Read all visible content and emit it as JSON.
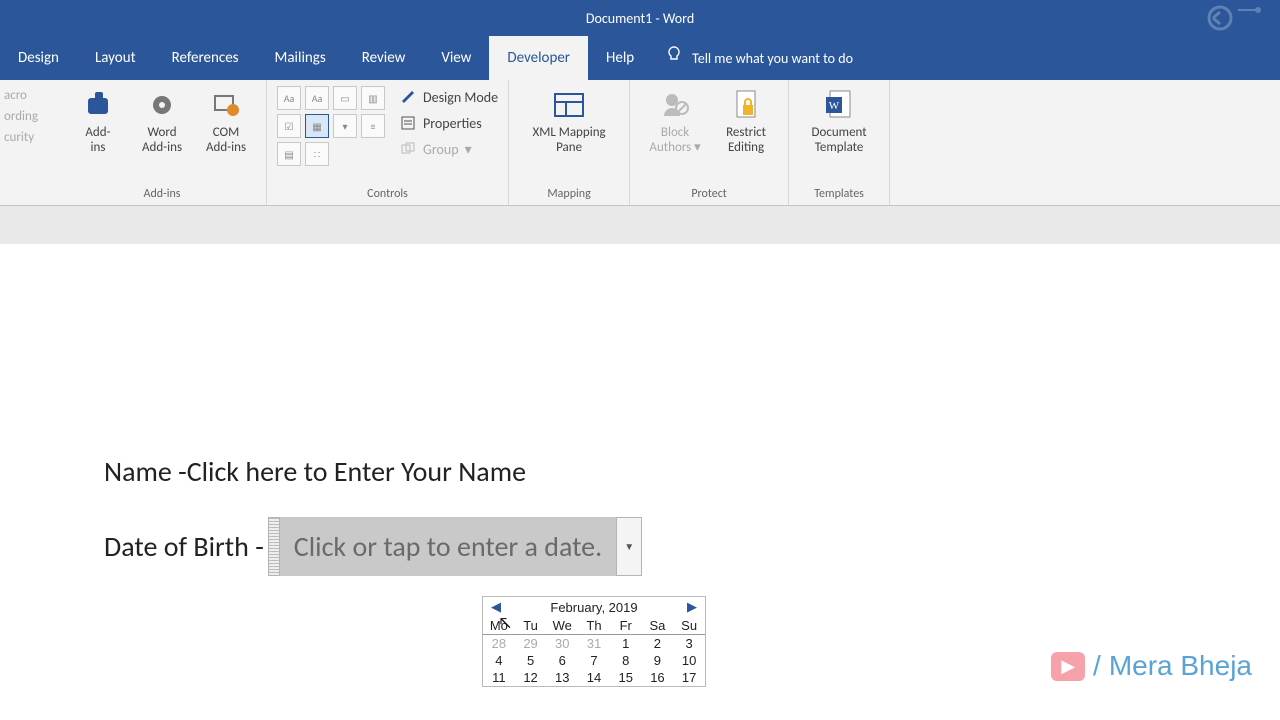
{
  "titlebar": {
    "title": "Document1  -  Word"
  },
  "tabs": [
    {
      "label": "Design",
      "active": false
    },
    {
      "label": "Layout",
      "active": false
    },
    {
      "label": "References",
      "active": false
    },
    {
      "label": "Mailings",
      "active": false
    },
    {
      "label": "Review",
      "active": false
    },
    {
      "label": "View",
      "active": false
    },
    {
      "label": "Developer",
      "active": true
    },
    {
      "label": "Help",
      "active": false
    }
  ],
  "tellme": "Tell me what you want to do",
  "leftcut": [
    "acro",
    "ording",
    "curity"
  ],
  "groups": {
    "addins": {
      "label": "Add-ins",
      "items": [
        {
          "line1": "Add-",
          "line2": "ins"
        },
        {
          "line1": "Word",
          "line2": "Add-ins"
        },
        {
          "line1": "COM",
          "line2": "Add-ins"
        }
      ]
    },
    "controls": {
      "label": "Controls",
      "right": {
        "design": "Design Mode",
        "properties": "Properties",
        "group": "Group"
      }
    },
    "mapping": {
      "label": "Mapping",
      "btn1": "XML Mapping",
      "btn2": "Pane"
    },
    "protect": {
      "label": "Protect",
      "block1": "Block",
      "block2": "Authors",
      "rest1": "Restrict",
      "rest2": "Editing"
    },
    "templates": {
      "label": "Templates",
      "t1": "Document",
      "t2": "Template"
    }
  },
  "doc": {
    "name_label": "Name -",
    "name_placeholder": "Click here to Enter Your Name",
    "dob_label": "Date of Birth -",
    "dob_placeholder": "Click or tap to enter a date."
  },
  "calendar": {
    "title": "February, 2019",
    "days": [
      "Mo",
      "Tu",
      "We",
      "Th",
      "Fr",
      "Sa",
      "Su"
    ],
    "rows": [
      [
        {
          "n": "28",
          "o": true
        },
        {
          "n": "29",
          "o": true
        },
        {
          "n": "30",
          "o": true
        },
        {
          "n": "31",
          "o": true
        },
        {
          "n": "1"
        },
        {
          "n": "2"
        },
        {
          "n": "3"
        }
      ],
      [
        {
          "n": "4"
        },
        {
          "n": "5"
        },
        {
          "n": "6"
        },
        {
          "n": "7"
        },
        {
          "n": "8"
        },
        {
          "n": "9"
        },
        {
          "n": "10"
        }
      ],
      [
        {
          "n": "11"
        },
        {
          "n": "12"
        },
        {
          "n": "13"
        },
        {
          "n": "14"
        },
        {
          "n": "15"
        },
        {
          "n": "16"
        },
        {
          "n": "17"
        }
      ]
    ]
  },
  "watermark": {
    "slash": " / ",
    "brand": "Mera Bheja"
  }
}
